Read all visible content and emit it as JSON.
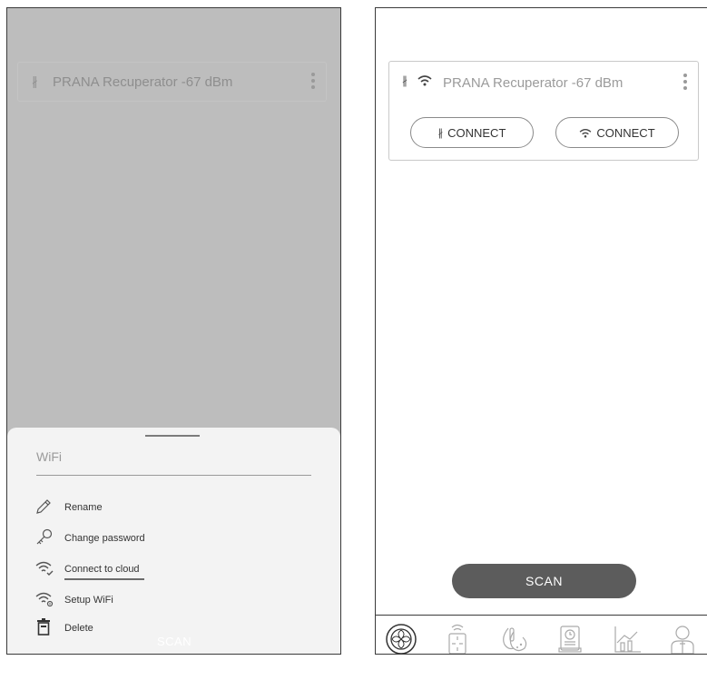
{
  "left_screen": {
    "device_row": {
      "bt_glyph": "∦",
      "name": "PRANA Recuperator -67 dBm"
    },
    "bottom_sheet": {
      "title": "WiFi",
      "items": [
        {
          "label": "Rename",
          "icon": "pencil-icon"
        },
        {
          "label": "Change password",
          "icon": "key-icon"
        },
        {
          "label": "Connect to cloud",
          "icon": "wifi-check-icon"
        },
        {
          "label": "Setup WiFi",
          "icon": "wifi-settings-icon"
        },
        {
          "label": "Delete",
          "icon": "trash-icon"
        }
      ],
      "scan_label": "SCAN"
    }
  },
  "right_screen": {
    "device_card": {
      "bt_glyph": "∦",
      "name": "PRANA Recuperator -67 dBm",
      "bt_connect_label": "CONNECT",
      "wifi_connect_label": "CONNECT"
    },
    "scan_label": "SCAN",
    "nav_icons": [
      "fan-mode-icon",
      "remote-control-icon",
      "climate-icon",
      "schedule-icon",
      "statistics-icon",
      "profile-icon"
    ]
  }
}
